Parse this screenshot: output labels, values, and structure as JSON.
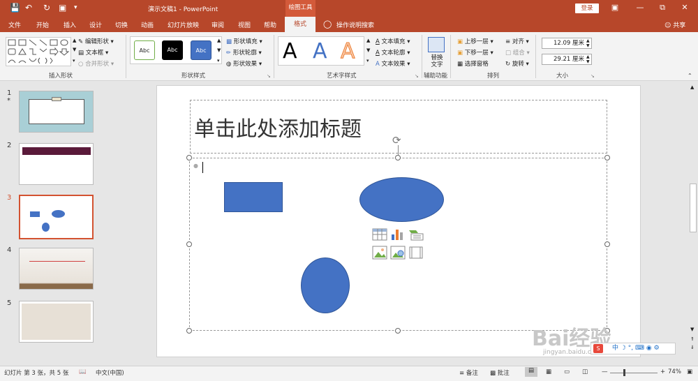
{
  "window": {
    "title": "演示文稿1  -  PowerPoint",
    "context_tab_group": "绘图工具",
    "login": "登录",
    "share": "共享"
  },
  "tabs": [
    {
      "label": "文件"
    },
    {
      "label": "开始"
    },
    {
      "label": "插入"
    },
    {
      "label": "设计"
    },
    {
      "label": "切换"
    },
    {
      "label": "动画"
    },
    {
      "label": "幻灯片放映"
    },
    {
      "label": "审阅"
    },
    {
      "label": "视图"
    },
    {
      "label": "帮助"
    },
    {
      "label": "格式"
    }
  ],
  "tell_me": "操作说明搜索",
  "ribbon": {
    "insert_shapes": {
      "label": "插入形状",
      "edit_shape": "编辑形状",
      "text_box": "文本框",
      "merge_shapes": "合并形状"
    },
    "shape_styles": {
      "label": "形状样式",
      "style_sample": "Abc",
      "fill": "形状填充",
      "outline": "形状轮廓",
      "effects": "形状效果"
    },
    "wordart": {
      "label": "艺术字样式",
      "sample": "A",
      "text_fill": "文本填充",
      "text_outline": "文本轮廓",
      "text_effects": "文本效果"
    },
    "accessibility": {
      "label": "辅助功能",
      "alt_text": "替换文字"
    },
    "arrange": {
      "label": "排列",
      "bring_forward": "上移一层",
      "send_backward": "下移一层",
      "selection_pane": "选择窗格",
      "align": "对齐",
      "group": "组合",
      "rotate": "旋转"
    },
    "size": {
      "label": "大小",
      "height": "12.09 厘米",
      "width": "29.21 厘米"
    }
  },
  "slides": [
    {
      "num": "1",
      "star": "*"
    },
    {
      "num": "2"
    },
    {
      "num": "3"
    },
    {
      "num": "4"
    },
    {
      "num": "5"
    }
  ],
  "canvas": {
    "title_placeholder": "单击此处添加标题",
    "shape_color": "#4472c4"
  },
  "status": {
    "slide_info": "幻灯片 第 3 张，共 5 张",
    "language": "中文(中国)",
    "notes": "备注",
    "comments": "批注",
    "zoom": "74%"
  },
  "watermark": {
    "brand": "Bai经验",
    "url": "jingyan.baidu.com"
  },
  "ime": "中"
}
